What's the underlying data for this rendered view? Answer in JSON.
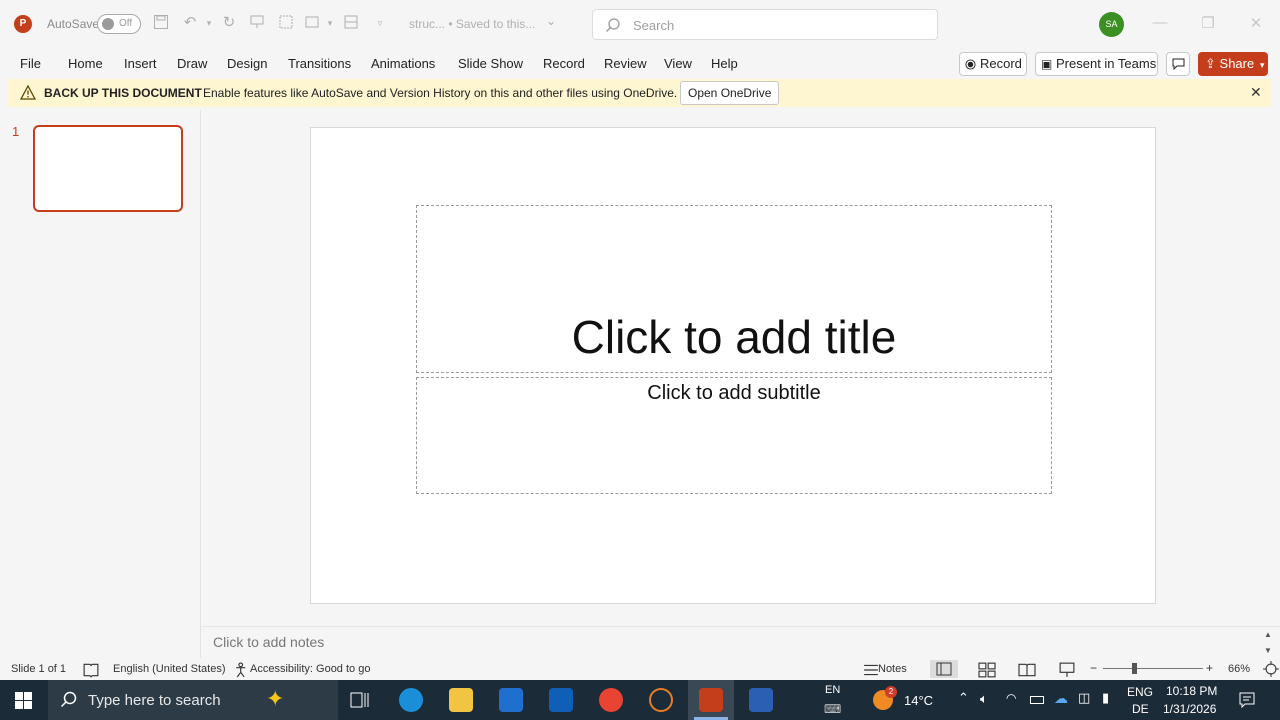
{
  "titlebar": {
    "app_badge": "P",
    "autosave_label": "AutoSave",
    "autosave_state": "Off",
    "doc_title": "struc...  •  Saved to this...",
    "search_placeholder": "Search",
    "avatar_initials": "SA"
  },
  "ribbon": {
    "tabs": [
      "File",
      "Home",
      "Insert",
      "Draw",
      "Design",
      "Transitions",
      "Animations",
      "Slide Show",
      "Record",
      "Review",
      "View",
      "Help"
    ],
    "record_label": "Record",
    "present_label": "Present in Teams",
    "share_label": "Share"
  },
  "notice": {
    "heading": "BACK UP THIS DOCUMENT",
    "message": "Enable features like AutoSave and Version History on this and other files using OneDrive.",
    "button": "Open OneDrive"
  },
  "thumbnails": {
    "slide_number": "1"
  },
  "slide": {
    "title_placeholder": "Click to add title",
    "subtitle_placeholder": "Click to add subtitle"
  },
  "notes_placeholder": "Click to add notes",
  "statusbar": {
    "slide_info": "Slide 1 of 1",
    "language": "English (United States)",
    "accessibility": "Accessibility: Good to go",
    "notes_label": "Notes",
    "zoom": "66%"
  },
  "taskbar": {
    "search_placeholder": "Type here to search",
    "input_lang_top": "EN",
    "weather_badge": "2",
    "temperature": "14°C",
    "lang_top": "ENG",
    "lang_bottom": "DE",
    "time": "10:18 PM",
    "date": "1/31/2026"
  },
  "colors": {
    "accent": "#c43e1c",
    "notice_bg": "#fdf6d0",
    "taskbar_bg": "#1c2b38"
  }
}
